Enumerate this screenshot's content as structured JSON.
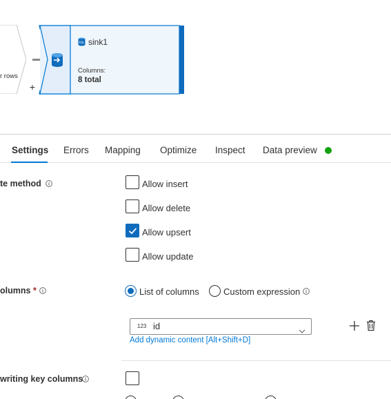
{
  "canvas": {
    "prev_node_label": "r rows",
    "add_label": "+",
    "sink": {
      "title": "sink1",
      "columns_label": "Columns:",
      "columns_value": "8 total"
    }
  },
  "tabs": [
    {
      "label": "Settings",
      "active": true
    },
    {
      "label": "Errors"
    },
    {
      "label": "Mapping"
    },
    {
      "label": "Optimize"
    },
    {
      "label": "Inspect"
    },
    {
      "label": "Data preview"
    }
  ],
  "colors": {
    "accent": "#0078d4",
    "status_ok": "#13a10e",
    "required": "#a4262c"
  },
  "settings": {
    "update_method_label": "te method",
    "options": [
      {
        "label": "Allow insert",
        "checked": false
      },
      {
        "label": "Allow delete",
        "checked": false
      },
      {
        "label": "Allow upsert",
        "checked": true
      },
      {
        "label": "Allow update",
        "checked": false
      }
    ],
    "key_columns_label": "olumns",
    "required_marker": "*",
    "key_mode": {
      "list_label": "List of columns",
      "expr_label": "Custom expression",
      "selected": "list"
    },
    "column_select": {
      "type_label": "123",
      "value": "id"
    },
    "dynamic_content_link": "Add dynamic content [Alt+Shift+D]",
    "skip_writing_label": "writing key columns"
  }
}
